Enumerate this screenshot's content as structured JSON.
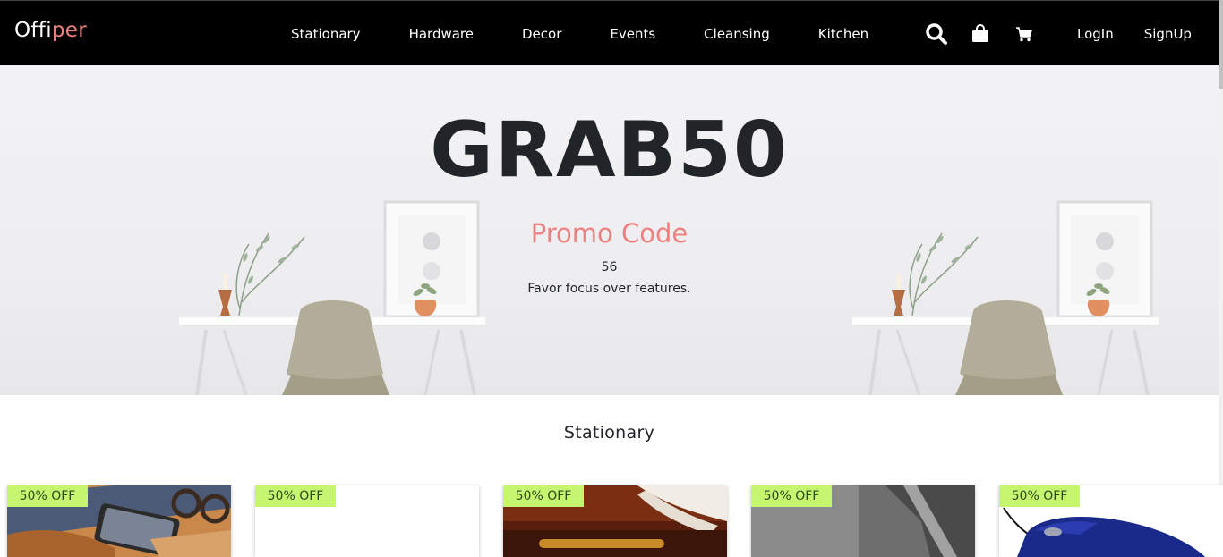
{
  "brand": {
    "part1": "Offi",
    "part2": "per"
  },
  "nav": {
    "links": [
      "Stationary",
      "Hardware",
      "Decor",
      "Events",
      "Cleansing",
      "Kitchen"
    ],
    "icons": [
      "search-icon",
      "shopping-bag-icon",
      "cart-icon"
    ],
    "login": "LogIn",
    "signup": "SignUp"
  },
  "hero": {
    "code": "GRAB50",
    "subtitle": "Promo Code",
    "number": "56",
    "tagline": "Favor focus over features."
  },
  "section": {
    "title": "Stationary",
    "products": [
      {
        "badge": "50% OFF",
        "image": "leather-wallet-phone-image"
      },
      {
        "badge": "50% OFF",
        "image": "blank-product-image"
      },
      {
        "badge": "50% OFF",
        "image": "quill-pen-image"
      },
      {
        "badge": "50% OFF",
        "image": "stapler-closeup-image"
      },
      {
        "badge": "50% OFF",
        "image": "computer-mouse-image"
      }
    ]
  },
  "colors": {
    "navbar": "#000000",
    "accent": "#f08080",
    "badge": "#c6f56f",
    "text": "#212529"
  }
}
